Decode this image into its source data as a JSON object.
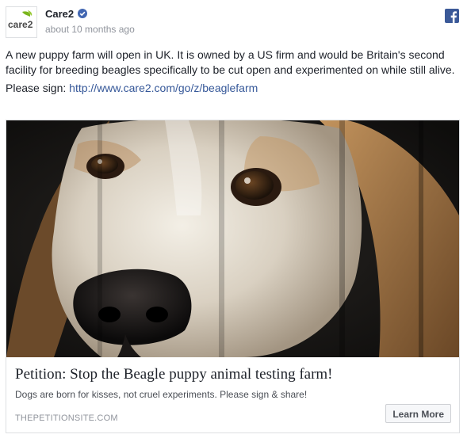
{
  "post": {
    "page_name": "Care2",
    "avatar_text": "care2",
    "timestamp": "about 10 months ago",
    "text": "A new puppy farm will open in UK. It is owned by a US firm and would be Britain's second facility for breeding beagles specifically to be cut open and experimented on while still alive.",
    "sign_prefix": "Please sign: ",
    "sign_link": "http://www.care2.com/go/z/beaglefarm"
  },
  "card": {
    "title": "Petition: Stop the Beagle puppy animal testing farm!",
    "description": "Dogs are born for kisses, not cruel experiments. Please sign & share!",
    "domain": "THEPETITIONSITE.COM",
    "cta_label": "Learn More"
  },
  "icons": {
    "verified": "verified-badge-icon",
    "facebook": "facebook-logo-icon"
  },
  "colors": {
    "link": "#365899",
    "facebook_blue": "#3b5998",
    "verified_blue": "#4267b2",
    "care2_green": "#7ab51d"
  }
}
